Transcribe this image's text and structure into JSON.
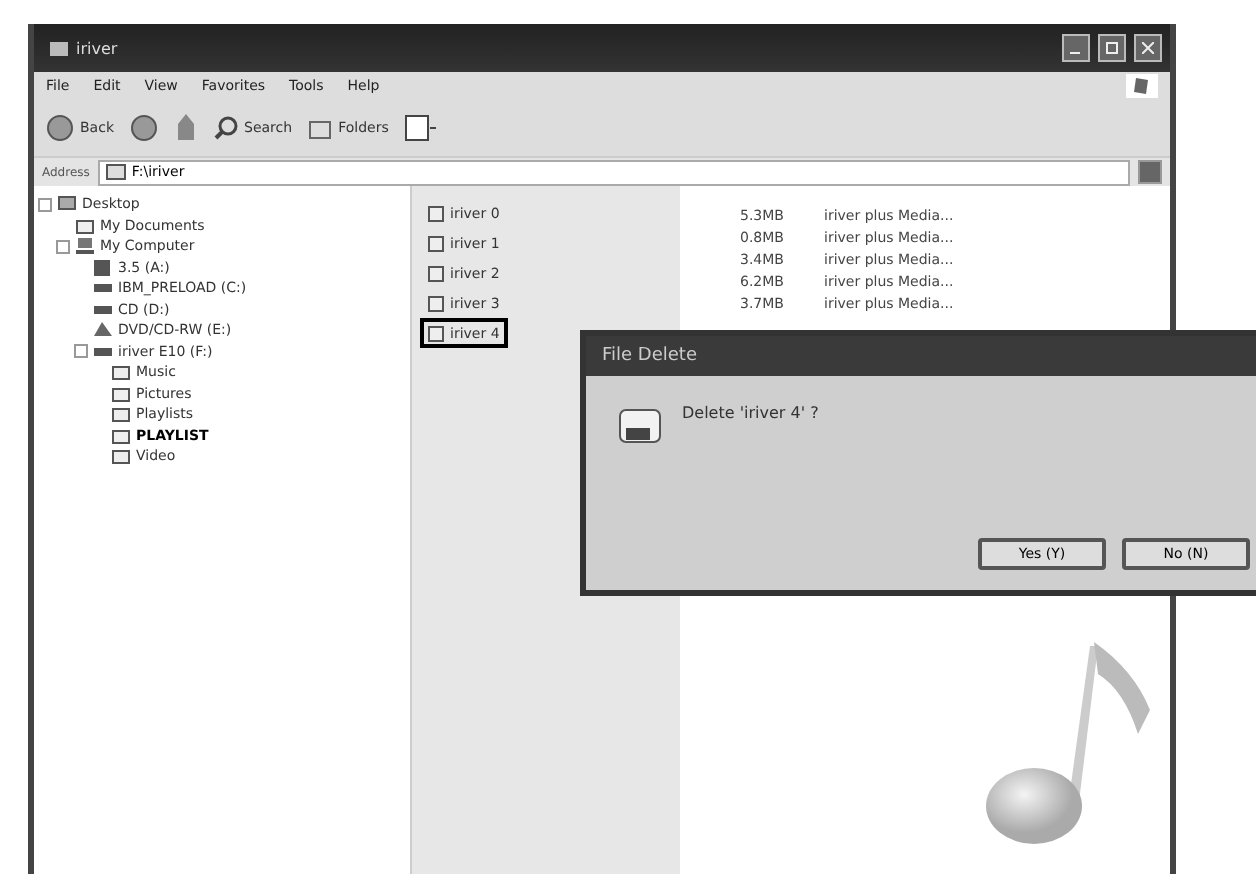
{
  "window": {
    "title": "iriver"
  },
  "menu": [
    "File",
    "Edit",
    "View",
    "Favorites",
    "Tools",
    "Help"
  ],
  "toolbar": [
    {
      "kind": "back",
      "label": "Back"
    },
    {
      "kind": "forward"
    },
    {
      "kind": "up"
    },
    {
      "kind": "search",
      "label": "Search"
    },
    {
      "kind": "folders",
      "label": "Folders"
    },
    {
      "kind": "views"
    }
  ],
  "address": {
    "label": "Address",
    "value": "F:\\iriver"
  },
  "tree": [
    {
      "label": "Desktop",
      "kind": "desktop",
      "selected": false,
      "children": [
        {
          "label": "My Documents",
          "kind": "folder",
          "selected": false
        },
        {
          "label": "My Computer",
          "kind": "computer",
          "selected": false,
          "children": [
            {
              "label": "3.5 (A:)",
              "kind": "floppy",
              "selected": false
            },
            {
              "label": "IBM_PRELOAD (C:)",
              "kind": "drive",
              "selected": false
            },
            {
              "label": "CD (D:)",
              "kind": "drive",
              "selected": false
            },
            {
              "label": "DVD/CD-RW (E:)",
              "kind": "cd",
              "selected": false
            },
            {
              "label": "iriver E10 (F:)",
              "kind": "drive",
              "selected": false,
              "children": [
                {
                  "label": "Music",
                  "kind": "folder",
                  "selected": false
                },
                {
                  "label": "Pictures",
                  "kind": "folder",
                  "selected": false
                },
                {
                  "label": "Playlists",
                  "kind": "folder",
                  "selected": false
                },
                {
                  "label": "PLAYLIST",
                  "kind": "folder",
                  "selected": true
                },
                {
                  "label": "Video",
                  "kind": "folder",
                  "selected": false
                }
              ]
            }
          ]
        }
      ]
    }
  ],
  "files": [
    {
      "name": "iriver 0",
      "size": "5.3MB",
      "type": "iriver plus Media...",
      "selected": false
    },
    {
      "name": "iriver 1",
      "size": "0.8MB",
      "type": "iriver plus Media...",
      "selected": false
    },
    {
      "name": "iriver 2",
      "size": "3.4MB",
      "type": "iriver plus Media...",
      "selected": false
    },
    {
      "name": "iriver 3",
      "size": "6.2MB",
      "type": "iriver plus Media...",
      "selected": false
    },
    {
      "name": "iriver 4",
      "size": "3.7MB",
      "type": "iriver plus Media...",
      "selected": true
    }
  ],
  "dialog": {
    "title": "File Delete",
    "message": "Delete 'iriver 4' ?",
    "buttons": [
      "Yes (Y)",
      "No (N)"
    ]
  }
}
